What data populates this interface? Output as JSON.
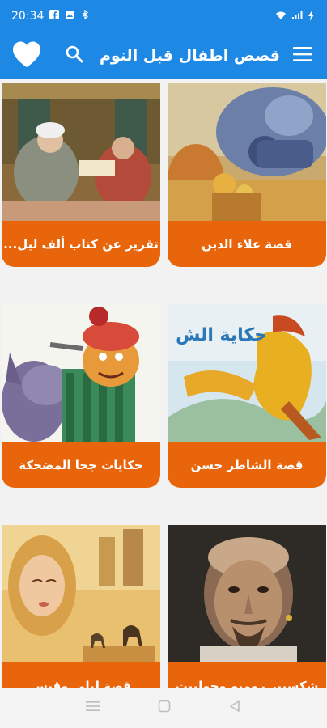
{
  "status_bar": {
    "time": "20:34"
  },
  "app_bar": {
    "title": "قصص اطفال قبل النوم",
    "icons": [
      "heart-icon",
      "search-icon",
      "menu-icon"
    ]
  },
  "stories": [
    {
      "title": "قصة علاء الدين"
    },
    {
      "title": "تقرير عن كتاب ألف ليل..."
    },
    {
      "title": "قصة الشاطر حسن"
    },
    {
      "title": "حكايات جحا المضحكة"
    },
    {
      "title": "شكسبير روميو وجولييت"
    },
    {
      "title": "قصة ليلى وقيس"
    }
  ],
  "colors": {
    "primary": "#1e88e5",
    "card_accent": "#e8650c",
    "background": "#f2f2f2"
  },
  "nav_bar": {
    "icons": [
      "recents-icon",
      "home-icon",
      "back-icon"
    ]
  }
}
